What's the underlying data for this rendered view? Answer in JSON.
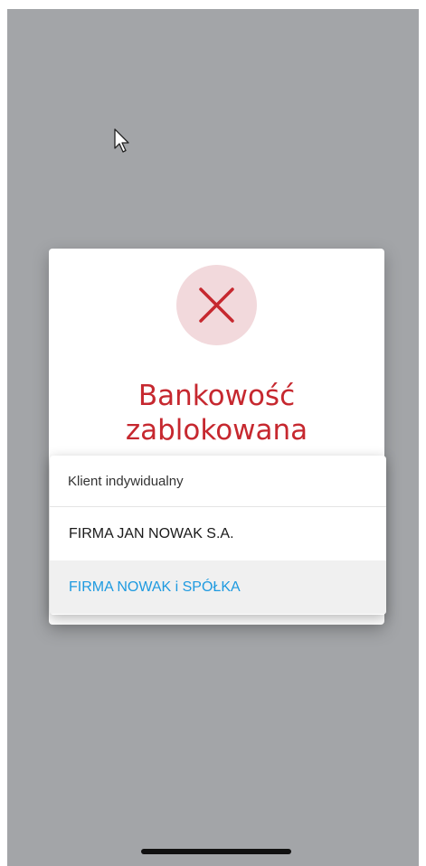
{
  "dialog": {
    "icon": "close-icon",
    "title_line1": "Bankowość",
    "title_line2": "zablokowana",
    "error_color": "#c6282f"
  },
  "account_picker": {
    "header": "Klient indywidualny",
    "items": [
      {
        "label": "FIRMA JAN NOWAK S.A.",
        "selected": false
      },
      {
        "label": "FIRMA NOWAK i SPÓŁKA",
        "selected": true
      }
    ],
    "selected_color": "#1e9ae0"
  }
}
